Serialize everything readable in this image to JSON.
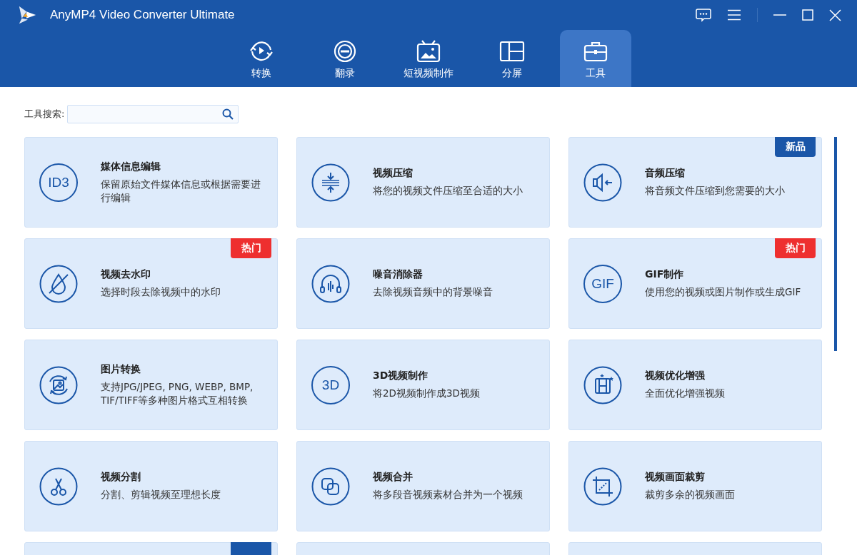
{
  "window": {
    "title": "AnyMP4 Video Converter Ultimate"
  },
  "tabs": [
    {
      "label": "转换",
      "selected": false
    },
    {
      "label": "翻录",
      "selected": false
    },
    {
      "label": "短视频制作",
      "selected": false
    },
    {
      "label": "分屏",
      "selected": false
    },
    {
      "label": "工具",
      "selected": true
    }
  ],
  "search": {
    "label": "工具搜索:"
  },
  "tools": [
    {
      "icon_text": "ID3",
      "title": "媒体信息编辑",
      "description": "保留原始文件媒体信息或根据需要进行编辑"
    },
    {
      "title": "视频压缩",
      "description": "将您的视频文件压缩至合适的大小"
    },
    {
      "title": "音频压缩",
      "description": "将音频文件压缩到您需要的大小",
      "badge": {
        "kind": "new",
        "text": "新品"
      }
    },
    {
      "title": "视频去水印",
      "description": "选择时段去除视频中的水印",
      "badge": {
        "kind": "hot",
        "text": "热门"
      }
    },
    {
      "title": "噪音消除器",
      "description": "去除视频音频中的背景噪音"
    },
    {
      "icon_text": "GIF",
      "title": "GIF制作",
      "description": "使用您的视频或图片制作或生成GIF",
      "badge": {
        "kind": "hot",
        "text": "热门"
      }
    },
    {
      "title": "图片转换",
      "description": "支持JPG/JPEG, PNG, WEBP, BMP, TIF/TIFF等多种图片格式互相转换"
    },
    {
      "icon_text": "3D",
      "title": "3D视频制作",
      "description": "将2D视频制作成3D视频"
    },
    {
      "title": "视频优化增强",
      "description": "全面优化增强视频"
    },
    {
      "title": "视频分割",
      "description": "分割、剪辑视频至理想长度"
    },
    {
      "title": "视频合并",
      "description": "将多段音视频素材合并为一个视频"
    },
    {
      "title": "视频画面裁剪",
      "description": "裁剪多余的视频画面"
    }
  ],
  "partial_cards": [
    {
      "badge_shown": true
    },
    {
      "badge_shown": false
    },
    {
      "badge_shown": false
    }
  ]
}
